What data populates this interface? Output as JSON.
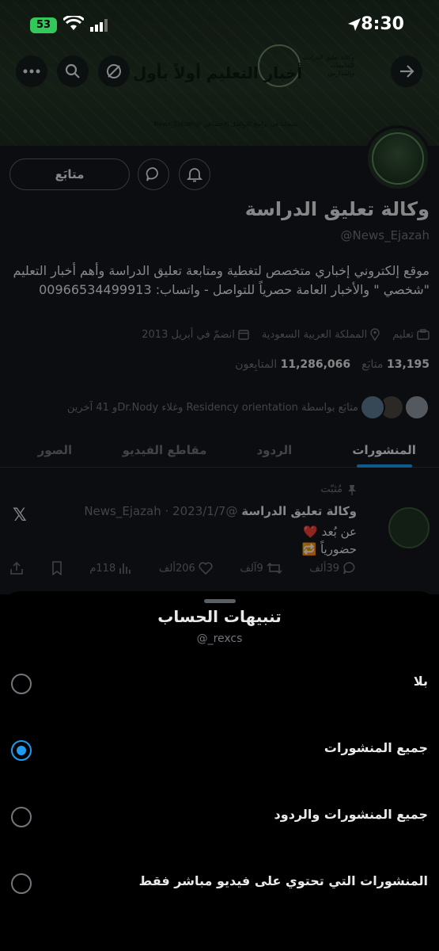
{
  "status_bar": {
    "time": "8:30",
    "battery": "53"
  },
  "banner": {
    "title": "أخبار التعليم أولاً بأول",
    "logo_text": "وكالة تعليق الدراسة للجامعات والمدارس",
    "social_line": "متصلنا في برامج التواصل الاجتماعي @News_Ejazah"
  },
  "profile": {
    "display_name": "وكالة تعليق الدراسة",
    "handle": "@News_Ejazah",
    "follow_label": "متابَع",
    "bio": "موقع إلكتروني إخباري متخصص لتغطية ومتابعة تعليق الدراسة وأهم أخبار التعليم \"شخصي \" والأخبار العامة حصرياً للتواصل - واتساب: 00966534499913",
    "category": "تعليم",
    "location": "المملكة العربية السعودية",
    "joined": "انضمّ في أبريل 2013",
    "following_count": "13,195",
    "following_label": "متابَع",
    "followers_count": "11,286,066",
    "followers_label": "المتابِعون",
    "followed_by": "متابَع بواسطة Residency orientation وغلاء Dr.Nodyو 41 آخرين"
  },
  "tabs": [
    {
      "label": "المنشورات"
    },
    {
      "label": "الردود"
    },
    {
      "label": "مقاطع الفيديو"
    },
    {
      "label": "الصور"
    }
  ],
  "tweet": {
    "pinned_label": "مُثبّت",
    "name": "وكالة تعليق الدراسة",
    "handle_date": "@News_Ejazah · 2023/1/7",
    "line1": "عن بُعد ❤️",
    "line2": "حضورياً 🔁",
    "replies": "39ألف",
    "retweets": "9آلف",
    "likes": "206ألف",
    "views": "118م"
  },
  "sheet": {
    "title": "تنبيهات الحساب",
    "subtitle": "@_rexcs",
    "options": [
      {
        "label": "بلا",
        "selected": false
      },
      {
        "label": "جميع المنشورات",
        "selected": true
      },
      {
        "label": "جميع المنشورات والردود",
        "selected": false
      },
      {
        "label": "المنشورات التي تحتوي على فيديو مباشر فقط",
        "selected": false
      }
    ]
  },
  "colors": {
    "accent": "#1d9bf0",
    "banner": "#243526",
    "sheet": "#000000"
  }
}
